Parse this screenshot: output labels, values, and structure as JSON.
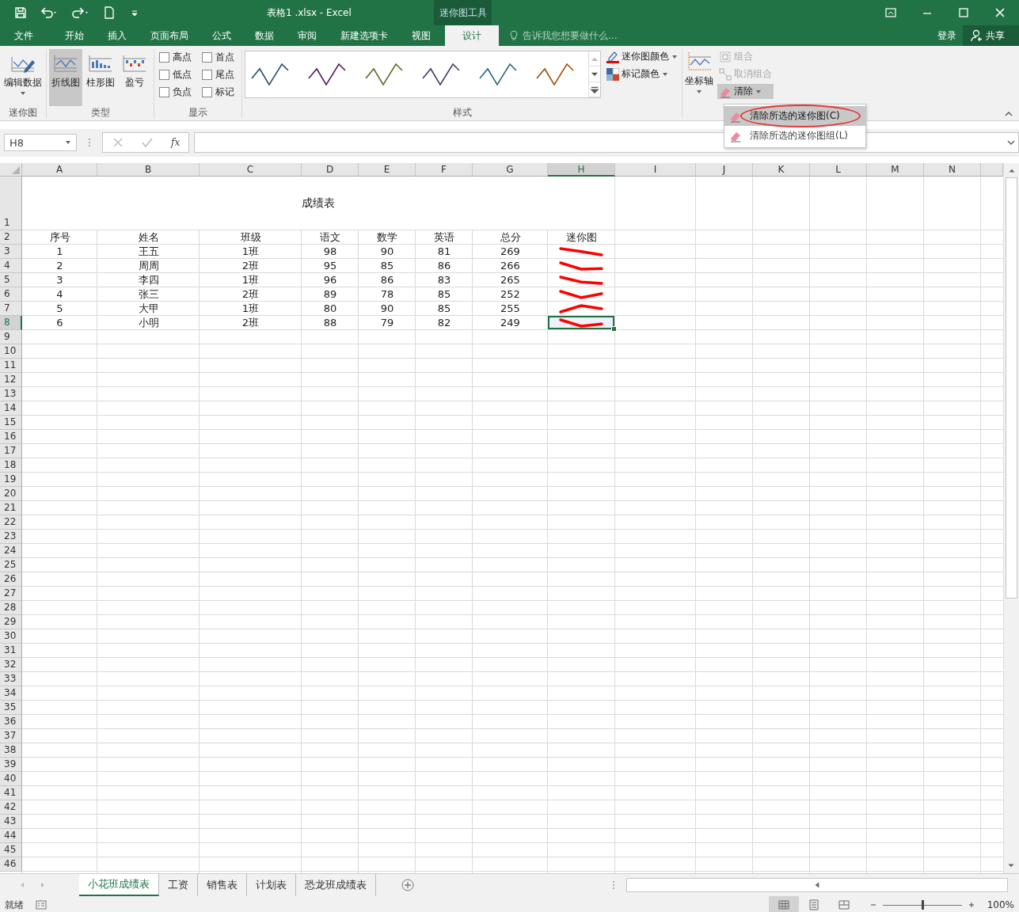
{
  "title_bar": {
    "title": "表格1 .xlsx - Excel",
    "context_tab": "迷你图工具"
  },
  "menu_tabs": [
    {
      "label": "文件",
      "selected": false
    },
    {
      "label": "开始",
      "selected": false
    },
    {
      "label": "插入",
      "selected": false
    },
    {
      "label": "页面布局",
      "selected": false
    },
    {
      "label": "公式",
      "selected": false
    },
    {
      "label": "数据",
      "selected": false
    },
    {
      "label": "审阅",
      "selected": false
    },
    {
      "label": "新建选项卡",
      "selected": false
    },
    {
      "label": "视图",
      "selected": false
    },
    {
      "label": "设计",
      "selected": true
    }
  ],
  "tell_me": {
    "placeholder": "告诉我您想要做什么..."
  },
  "account": {
    "sign_in": "登录",
    "share": "共享"
  },
  "ribbon": {
    "sparkline_group": {
      "label": "迷你图",
      "edit_button": "编辑数据"
    },
    "type_group": {
      "label": "类型",
      "types": [
        {
          "kind": "line",
          "label": "折线图",
          "selected": true
        },
        {
          "kind": "column",
          "label": "柱形图",
          "selected": false
        },
        {
          "kind": "winloss",
          "label": "盈亏",
          "selected": false
        }
      ]
    },
    "show_group": {
      "label": "显示",
      "options": [
        {
          "label": "高点",
          "checked": false
        },
        {
          "label": "首点",
          "checked": false
        },
        {
          "label": "低点",
          "checked": false
        },
        {
          "label": "尾点",
          "checked": false
        },
        {
          "label": "负点",
          "checked": false
        },
        {
          "label": "标记",
          "checked": false
        }
      ]
    },
    "style_group": {
      "label": "样式",
      "styles": [
        {
          "color": "#2f4b6e"
        },
        {
          "color": "#5b1a5b"
        },
        {
          "color": "#5a6e2a"
        },
        {
          "color": "#4a3a63"
        },
        {
          "color": "#2e6b7a"
        },
        {
          "color": "#a05012"
        }
      ],
      "sparkline_color": "迷你图颜色",
      "marker_color": "标记颜色"
    },
    "group_group": {
      "axis": "坐标轴",
      "group": {
        "label": "组合",
        "disabled": true
      },
      "ungroup": {
        "label": "取消组合",
        "disabled": true
      },
      "clear": {
        "label": "清除",
        "expanded": true
      }
    }
  },
  "clear_menu": [
    {
      "label": "清除所选的迷你图(C)",
      "selected": true
    },
    {
      "label": "清除所选的迷你图组(L)",
      "selected": false
    }
  ],
  "formula_bar": {
    "name_box": "H8",
    "function_label": "fx"
  },
  "sheet": {
    "columns": [
      {
        "label": "A",
        "selected": false
      },
      {
        "label": "B",
        "selected": false
      },
      {
        "label": "C",
        "selected": false
      },
      {
        "label": "D",
        "selected": false
      },
      {
        "label": "E",
        "selected": false
      },
      {
        "label": "F",
        "selected": false
      },
      {
        "label": "G",
        "selected": false
      },
      {
        "label": "H",
        "selected": true
      },
      {
        "label": "I",
        "selected": false
      },
      {
        "label": "J",
        "selected": false
      },
      {
        "label": "K",
        "selected": false
      },
      {
        "label": "L",
        "selected": false
      },
      {
        "label": "M",
        "selected": false
      },
      {
        "label": "N",
        "selected": false
      }
    ],
    "rows": [
      {
        "number": "1",
        "selected": false
      },
      {
        "number": "2",
        "selected": false
      },
      {
        "number": "3",
        "selected": false
      },
      {
        "number": "4",
        "selected": false
      },
      {
        "number": "5",
        "selected": false
      },
      {
        "number": "6",
        "selected": false
      },
      {
        "number": "7",
        "selected": false
      },
      {
        "number": "8",
        "selected": true
      },
      {
        "number": "9",
        "selected": false
      },
      {
        "number": "10",
        "selected": false
      },
      {
        "number": "11",
        "selected": false
      },
      {
        "number": "12",
        "selected": false
      },
      {
        "number": "13",
        "selected": false
      },
      {
        "number": "14",
        "selected": false
      },
      {
        "number": "15",
        "selected": false
      },
      {
        "number": "16",
        "selected": false
      },
      {
        "number": "17",
        "selected": false
      },
      {
        "number": "18",
        "selected": false
      },
      {
        "number": "19",
        "selected": false
      },
      {
        "number": "20",
        "selected": false
      },
      {
        "number": "21",
        "selected": false
      },
      {
        "number": "22",
        "selected": false
      },
      {
        "number": "23",
        "selected": false
      },
      {
        "number": "24",
        "selected": false
      },
      {
        "number": "25",
        "selected": false
      },
      {
        "number": "26",
        "selected": false
      },
      {
        "number": "27",
        "selected": false
      },
      {
        "number": "28",
        "selected": false
      },
      {
        "number": "29",
        "selected": false
      },
      {
        "number": "30",
        "selected": false
      },
      {
        "number": "31",
        "selected": false
      },
      {
        "number": "32",
        "selected": false
      },
      {
        "number": "33",
        "selected": false
      },
      {
        "number": "34",
        "selected": false
      },
      {
        "number": "35",
        "selected": false
      },
      {
        "number": "36",
        "selected": false
      },
      {
        "number": "37",
        "selected": false
      },
      {
        "number": "38",
        "selected": false
      },
      {
        "number": "39",
        "selected": false
      },
      {
        "number": "40",
        "selected": false
      },
      {
        "number": "41",
        "selected": false
      },
      {
        "number": "42",
        "selected": false
      },
      {
        "number": "43",
        "selected": false
      },
      {
        "number": "44",
        "selected": false
      },
      {
        "number": "45",
        "selected": false
      },
      {
        "number": "46",
        "selected": false
      }
    ],
    "title": "成绩表",
    "header_row": [
      "序号",
      "姓名",
      "班级",
      "语文",
      "数学",
      "英语",
      "总分",
      "迷你图"
    ],
    "data_rows": [
      {
        "cells": [
          "1",
          "王五",
          "1班",
          "98",
          "90",
          "81",
          "269"
        ],
        "selected": false
      },
      {
        "cells": [
          "2",
          "周周",
          "2班",
          "95",
          "85",
          "86",
          "266"
        ],
        "selected": false
      },
      {
        "cells": [
          "3",
          "李四",
          "1班",
          "96",
          "86",
          "83",
          "265"
        ],
        "selected": false
      },
      {
        "cells": [
          "4",
          "张三",
          "2班",
          "89",
          "78",
          "85",
          "252"
        ],
        "selected": false
      },
      {
        "cells": [
          "5",
          "大甲",
          "1班",
          "80",
          "90",
          "85",
          "255"
        ],
        "selected": false
      },
      {
        "cells": [
          "6",
          "小明",
          "2班",
          "88",
          "79",
          "82",
          "249"
        ],
        "selected": true
      }
    ]
  },
  "sheet_tabs": [
    {
      "label": "小花班成绩表",
      "selected": true
    },
    {
      "label": "工资",
      "selected": false
    },
    {
      "label": "销售表",
      "selected": false
    },
    {
      "label": "计划表",
      "selected": false
    },
    {
      "label": "恐龙班成绩表",
      "selected": false
    }
  ],
  "status_bar": {
    "status": "就绪",
    "views": [
      {
        "kind": "normal",
        "selected": true
      },
      {
        "kind": "page_layout",
        "selected": false
      },
      {
        "kind": "page_break",
        "selected": false
      }
    ],
    "zoom": {
      "level": 0.5,
      "reading": "100%"
    }
  }
}
